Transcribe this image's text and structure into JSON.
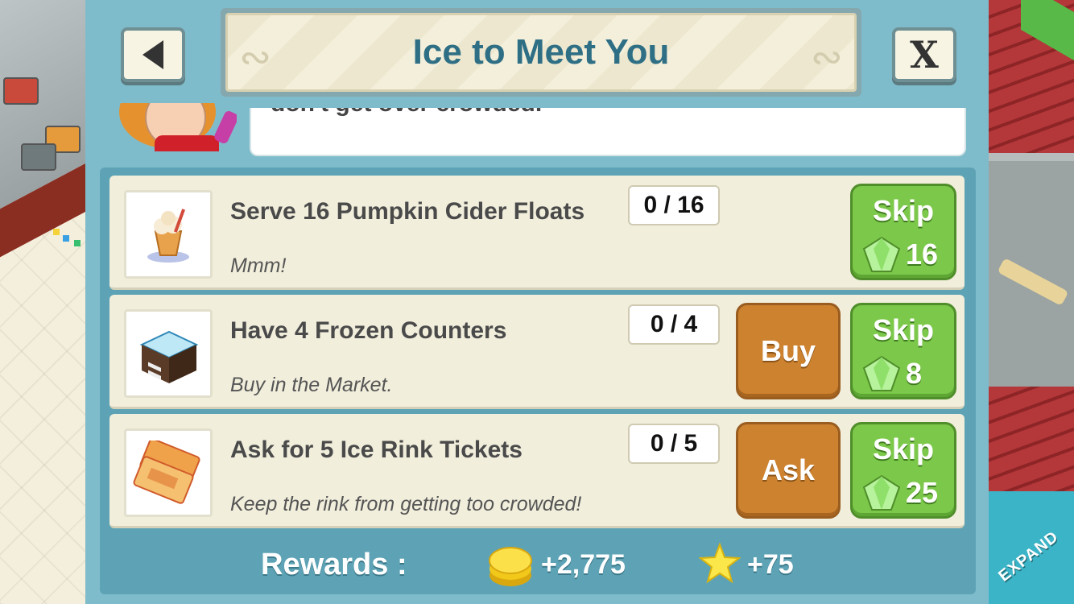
{
  "title": "Ice to Meet You",
  "nav": {
    "back_icon": "back-arrow-icon",
    "close_label": "X"
  },
  "speech": {
    "text": "don't get over crowded."
  },
  "tasks": [
    {
      "label": "Serve 16 Pumpkin Cider Floats",
      "desc": "Mmm!",
      "progress": "0 / 16",
      "action": "",
      "skip_label": "Skip",
      "skip_cost": "16",
      "icon": "pumpkin-cider-float-icon"
    },
    {
      "label": "Have 4 Frozen Counters",
      "desc": "Buy in the Market.",
      "progress": "0 / 4",
      "action": "Buy",
      "skip_label": "Skip",
      "skip_cost": "8",
      "icon": "frozen-counter-icon"
    },
    {
      "label": "Ask for 5 Ice Rink Tickets",
      "desc": "Keep the rink from getting too crowded!",
      "progress": "0 / 5",
      "action": "Ask",
      "skip_label": "Skip",
      "skip_cost": "25",
      "icon": "ice-rink-ticket-icon"
    }
  ],
  "rewards": {
    "label": "Rewards :",
    "coins": "+2,775",
    "stars": "+75"
  },
  "scene": {
    "expand_label": "EXPAND"
  },
  "colors": {
    "panel": "#7fbccb",
    "title": "#2f6f85",
    "skip_green": "#7cc84a",
    "action_orange": "#cd8230"
  }
}
